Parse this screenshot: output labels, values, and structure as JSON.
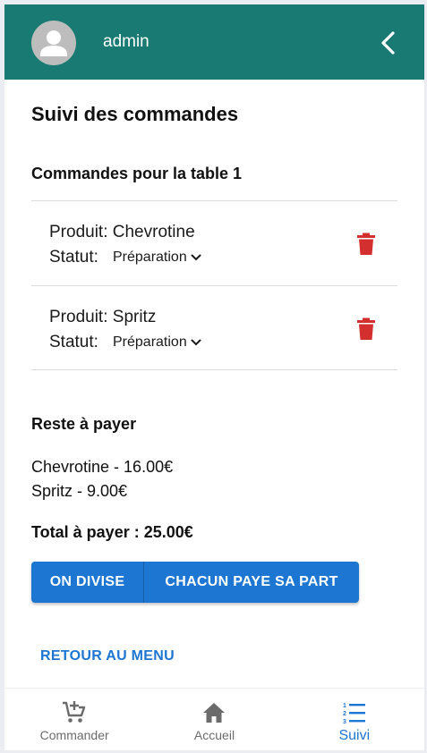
{
  "header": {
    "username": "admin"
  },
  "page": {
    "title": "Suivi des commandes",
    "section_title": "Commandes pour la table 1"
  },
  "orders": [
    {
      "product_prefix": "Produit:",
      "product": "Chevrotine",
      "status_label": "Statut:",
      "status": "Préparation"
    },
    {
      "product_prefix": "Produit:",
      "product": "Spritz",
      "status_label": "Statut:",
      "status": "Préparation"
    }
  ],
  "remaining": {
    "title": "Reste à payer",
    "items": [
      "Chevrotine - 16.00€",
      "Spritz - 9.00€"
    ],
    "total": "Total à payer : 25.00€"
  },
  "actions": {
    "split_label": "ON DIVISE",
    "each_pays_label": "CHACUN PAYE SA PART",
    "back_menu_label": "RETOUR AU MENU"
  },
  "bottom_nav": {
    "items": [
      {
        "label": "Commander",
        "icon": "cart-plus-icon"
      },
      {
        "label": "Accueil",
        "icon": "home-icon"
      },
      {
        "label": "Suivi",
        "icon": "numbered-list-icon",
        "active": true
      }
    ]
  },
  "colors": {
    "appbar": "#187a72",
    "primary": "#1d76d2",
    "delete": "#d32f2f",
    "nav_inactive": "#6b6b6b"
  }
}
